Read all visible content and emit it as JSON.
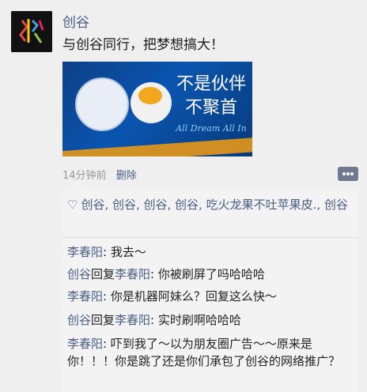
{
  "post": {
    "author": "创谷",
    "text": "与创谷同行，把梦想搞大！",
    "banner": {
      "slogan_line1": "不是伙伴",
      "slogan_line2": "不聚首",
      "tagline": "All Dream All In"
    },
    "time": "14分钟前",
    "delete_label": "删除"
  },
  "likes": {
    "icon": "heart-icon",
    "names": "创谷, 创谷, 创谷, 创谷, 吃火龙果不吐苹果皮., 创谷"
  },
  "comments": [
    {
      "name": "李春阳",
      "text": ": 我去～"
    },
    {
      "name": "创谷",
      "reply_word": "回复",
      "reply_to": "李春阳",
      "text": ": 你被刷屏了吗哈哈哈"
    },
    {
      "name": "李春阳",
      "text": ": 你是机器阿妹么？回复这么快～"
    },
    {
      "name": "创谷",
      "reply_word": "回复",
      "reply_to": "李春阳",
      "text": ": 实时刷啊哈哈哈"
    },
    {
      "name": "李春阳",
      "text": ": 吓到我了～以为朋友圈广告～～原来是你！！！你是跳了还是你们承包了创谷的网络推广？"
    }
  ],
  "colors": {
    "link": "#4a5d85",
    "background": "#efefef",
    "panel": "#f3f3f3"
  }
}
